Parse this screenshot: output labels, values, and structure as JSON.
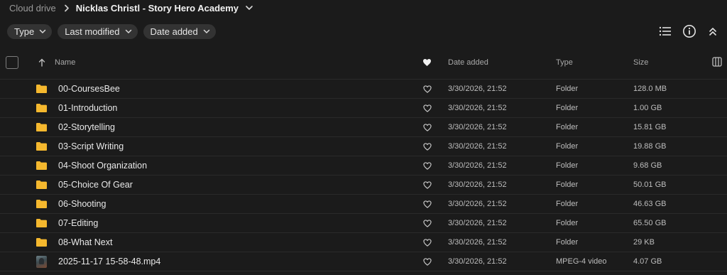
{
  "breadcrumb": {
    "root": "Cloud drive",
    "current": "Nicklas Christl - Story Hero Academy"
  },
  "filters": [
    {
      "label": "Type"
    },
    {
      "label": "Last modified"
    },
    {
      "label": "Date added"
    }
  ],
  "columns": {
    "name": "Name",
    "date_added": "Date added",
    "type": "Type",
    "size": "Size"
  },
  "colors": {
    "background": "#1b1b1b",
    "chip": "#333333",
    "folder": "#f5b82e",
    "divider": "#2a2a2a"
  },
  "rows": [
    {
      "kind": "folder",
      "name": "00-CoursesBee",
      "date": "3/30/2026, 21:52",
      "type": "Folder",
      "size": "128.0 MB"
    },
    {
      "kind": "folder",
      "name": "01-Introduction",
      "date": "3/30/2026, 21:52",
      "type": "Folder",
      "size": "1.00 GB"
    },
    {
      "kind": "folder",
      "name": "02-Storytelling",
      "date": "3/30/2026, 21:52",
      "type": "Folder",
      "size": "15.81 GB"
    },
    {
      "kind": "folder",
      "name": "03-Script Writing",
      "date": "3/30/2026, 21:52",
      "type": "Folder",
      "size": "19.88 GB"
    },
    {
      "kind": "folder",
      "name": "04-Shoot Organization",
      "date": "3/30/2026, 21:52",
      "type": "Folder",
      "size": "9.68 GB"
    },
    {
      "kind": "folder",
      "name": "05-Choice Of Gear",
      "date": "3/30/2026, 21:52",
      "type": "Folder",
      "size": "50.01 GB"
    },
    {
      "kind": "folder",
      "name": "06-Shooting",
      "date": "3/30/2026, 21:52",
      "type": "Folder",
      "size": "46.63 GB"
    },
    {
      "kind": "folder",
      "name": "07-Editing",
      "date": "3/30/2026, 21:52",
      "type": "Folder",
      "size": "65.50 GB"
    },
    {
      "kind": "folder",
      "name": "08-What Next",
      "date": "3/30/2026, 21:52",
      "type": "Folder",
      "size": "29 KB"
    },
    {
      "kind": "video",
      "name": "2025-11-17 15-58-48.mp4",
      "date": "3/30/2026, 21:52",
      "type": "MPEG-4 video",
      "size": "4.07 GB"
    }
  ]
}
